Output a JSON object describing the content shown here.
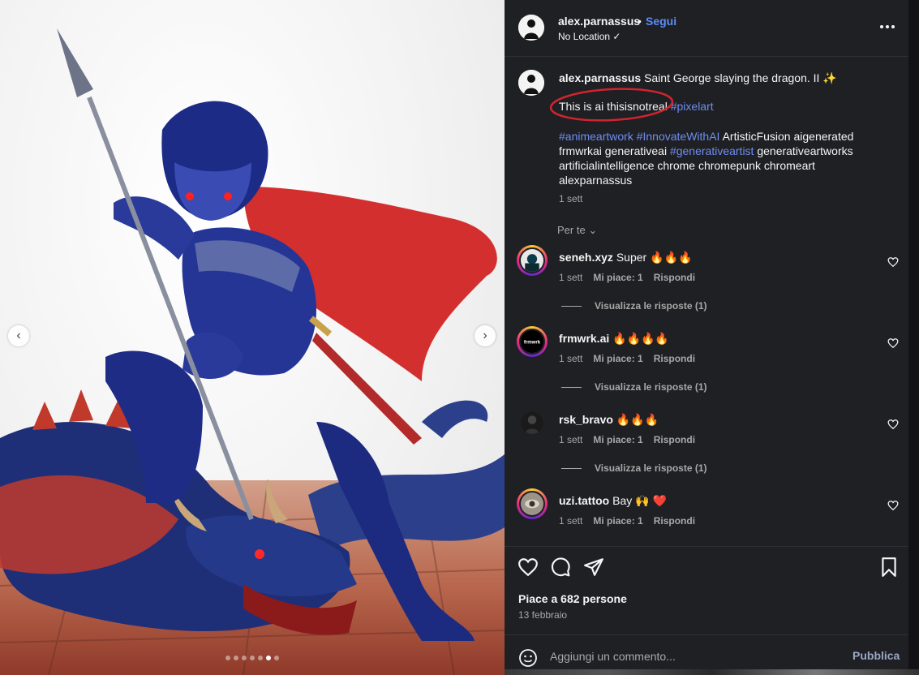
{
  "post": {
    "username": "alex.parnassus",
    "separator": "•",
    "follow_label": "Segui",
    "location": "No Location ✓",
    "caption_text": "Saint George slaying the dragon. II ✨",
    "caption_line2_text": "This is ai thisisnotreal",
    "caption_line2_tag": "#pixelart",
    "tags_line": [
      {
        "text": "#animeartwork",
        "tag": true
      },
      {
        "text": " ",
        "tag": false
      },
      {
        "text": "#InnovateWithAI",
        "tag": true
      },
      {
        "text": " ArtisticFusion aigenerated frmwrkai generativeai ",
        "tag": false
      },
      {
        "text": "#generativeartist",
        "tag": true
      },
      {
        "text": " generativeartworks artificialintelligence chrome chromepunk chromeart alexparnassus",
        "tag": false
      }
    ],
    "caption_time": "1 sett",
    "for_you_label": "Per te",
    "chevron_glyph": "⌄"
  },
  "media": {
    "prev_glyph": "‹",
    "next_glyph": "›",
    "dot_count": 7,
    "active_dot": 5
  },
  "comments": [
    {
      "user": "seneh.xyz",
      "text": "Super 🔥🔥🔥",
      "time": "1 sett",
      "likes": "Mi piace: 1",
      "reply": "Rispondi",
      "view_replies": "Visualizza le risposte (1)",
      "ring": true
    },
    {
      "user": "frmwrk.ai",
      "text": "🔥🔥🔥🔥",
      "time": "1 sett",
      "likes": "Mi piace: 1",
      "reply": "Rispondi",
      "view_replies": "Visualizza le risposte (1)",
      "ring": true
    },
    {
      "user": "rsk_bravo",
      "text": "🔥🔥🔥",
      "time": "1 sett",
      "likes": "Mi piace: 1",
      "reply": "Rispondi",
      "view_replies": "Visualizza le risposte (1)",
      "ring": false
    },
    {
      "user": "uzi.tattoo",
      "text": "Bay 🙌 ❤️",
      "time": "1 sett",
      "likes": "Mi piace: 1",
      "reply": "Rispondi",
      "view_replies": "",
      "ring": true
    }
  ],
  "footer": {
    "likes_text": "Piace a 682 persone",
    "date_text": "13 febbraio",
    "comment_placeholder": "Aggiungi un commento...",
    "publish_label": "Pubblica"
  },
  "colors": {
    "panel_bg": "#1f2024",
    "link_blue": "#5c8df6",
    "hashtag_blue": "#6e8df0",
    "annotation_red": "#d1242f"
  }
}
